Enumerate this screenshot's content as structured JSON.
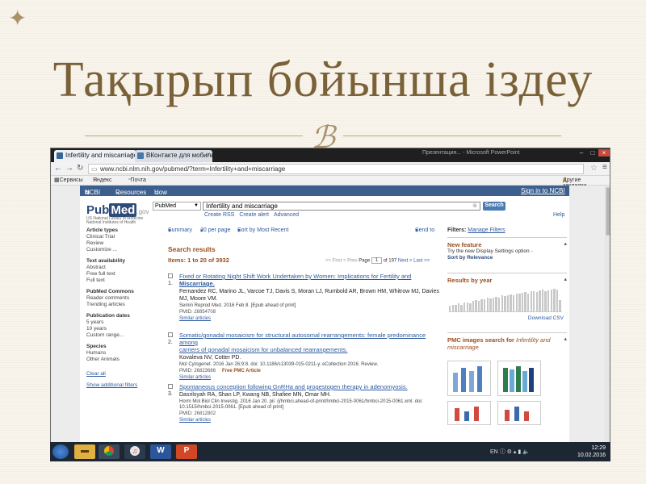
{
  "slide": {
    "title": "Тақырып бойынша іздеу",
    "corner_icon": "four-point-star-icon",
    "ornament_icon": "swash-ornament-icon"
  },
  "browser": {
    "tabs": [
      {
        "label": "Infertility and miscarriage",
        "icon": "pubmed-favicon"
      },
      {
        "label": "ВКонтакте для мобильн...",
        "icon": "vk-favicon"
      }
    ],
    "other_window_label": "Презентация... - Microsoft PowerPoint",
    "url_prefix": "www.ncbi.nlm.nih.gov/pubmed/?term=Infertility+and+miscarriage",
    "bookmarks": [
      "Сервисы",
      "Яндекс",
      "Почта"
    ],
    "bookmarks_other": "Другие закладки"
  },
  "ncbi": {
    "brand": "NCBI",
    "resources": "Resources",
    "how_to": "How To",
    "sign_in": "Sign in to NCBI",
    "logo_pub": "Pub",
    "logo_med": "Med",
    "logo_gov": ".gov",
    "logo_sub1": "US National Library of Medicine",
    "logo_sub2": "National Institutes of Health",
    "db_value": "PubMed",
    "query_value": "Infertility and miscarriage",
    "search_label": "Search",
    "create_rss": "Create RSS",
    "create_alert": "Create alert",
    "advanced": "Advanced",
    "help": "Help"
  },
  "left_filters": {
    "article_types": {
      "title": "Article types",
      "items": [
        "Clinical Trial",
        "Review",
        "Customize ..."
      ]
    },
    "text_availability": {
      "title": "Text availability",
      "items": [
        "Abstract",
        "Free full text",
        "Full text"
      ]
    },
    "pubmed_commons": {
      "title": "PubMed Commons",
      "items": [
        "Reader comments",
        "Trending articles"
      ]
    },
    "publication_dates": {
      "title": "Publication dates",
      "items": [
        "5 years",
        "10 years",
        "Custom range..."
      ]
    },
    "species": {
      "title": "Species",
      "items": [
        "Humans",
        "Other Animals"
      ]
    },
    "clear_all": "Clear all",
    "show_additional": "Show additional filters"
  },
  "results": {
    "summary": "Summary",
    "per_page": "20 per page",
    "sort": "Sort by Most Recent",
    "send_to": "Send to",
    "title": "Search results",
    "items": "Items: 1 to 20 of 3932",
    "pager": {
      "first": "<< First",
      "prev": "< Prev",
      "page_label": "Page",
      "page": "1",
      "of": "of 197",
      "next": "Next >",
      "last": "Last >>"
    },
    "list": [
      {
        "num": "1.",
        "title_a": "Fixed or Rotating Night Shift Work Undertaken by Women: Implications for Fertility and",
        "title_b": "Miscarriage.",
        "authors": "Fernandez RC, Marino JL, Varcoe TJ, Davis S, Moran LJ, Rumbold AR, Brown HM, Whitrow MJ, Davies MJ, Moore VM.",
        "journal": "Semin Reprod Med. 2016 Feb 8. [Epub ahead of print]",
        "pmid": "PMID: 26854708",
        "free": "",
        "similar": "Similar articles"
      },
      {
        "num": "2.",
        "title_a": "Somatic/gonadal mosaicism for structural autosomal rearrangements: female predominance among",
        "title_b": "carriers of gonadal mosaicism for unbalanced rearrangements.",
        "authors": "Kovaleva NV, Cotter PD.",
        "journal": "Mol Cytogenet. 2016 Jan 26;9:8. doi: 10.1186/s13039-015-0211-y. eCollection 2016. Review.",
        "pmid": "PMID: 26823686",
        "free": "Free PMC Article",
        "similar": "Similar articles"
      },
      {
        "num": "3.",
        "title_a": "Spontaneous conception following GnRHa and progestogen therapy in adenomyosis.",
        "title_b": "",
        "authors": "Dasrilsyah RA, Shan LP, Kwang NB, Shafiee MN, Omar MH.",
        "journal": "Horm Mol Biol Clin Investig. 2016 Jan 20. pii: /j/hmbci.ahead-of-print/hmbci-2015-0061/hmbci-2015-0061.xml. doi: 10.1515/hmbci-2015-0061. [Epub ahead of print]",
        "pmid": "PMID: 26812802",
        "free": "",
        "similar": "Similar articles"
      }
    ]
  },
  "right_panel": {
    "filters_label": "Filters:",
    "manage_filters": "Manage Filters",
    "new_feature_title": "New feature",
    "new_feature_text": "Try the new Display Settings option -",
    "new_feature_link": "Sort by Relevance",
    "by_year_title": "Results by year",
    "download_csv": "Download CSV",
    "pmc_title": "PMC images search for",
    "pmc_query": "Infertility and miscarriage",
    "by_year_bars": [
      0.25,
      0.3,
      0.28,
      0.35,
      0.3,
      0.38,
      0.4,
      0.36,
      0.45,
      0.5,
      0.48,
      0.55,
      0.52,
      0.6,
      0.58,
      0.62,
      0.65,
      0.6,
      0.7,
      0.68,
      0.72,
      0.75,
      0.7,
      0.78,
      0.8,
      0.82,
      0.85,
      0.8,
      0.88,
      0.9,
      0.86,
      0.92,
      0.95,
      0.9,
      0.93,
      0.97,
      1.0,
      0.96,
      0.5
    ]
  },
  "taskbar": {
    "apps": [
      "windows-start-icon",
      "explorer-folder-icon",
      "chrome-icon",
      "itunes-icon",
      "word-icon",
      "powerpoint-icon"
    ],
    "word_glyph": "W",
    "ppt_glyph": "P",
    "lang": "EN",
    "time": "12:29",
    "date": "10.02.2016"
  },
  "colors": {
    "title": "#7a6138",
    "ncbi_blue": "#3c5f8e",
    "link": "#2c5aa0",
    "heading_orange": "#9b4d1c"
  }
}
